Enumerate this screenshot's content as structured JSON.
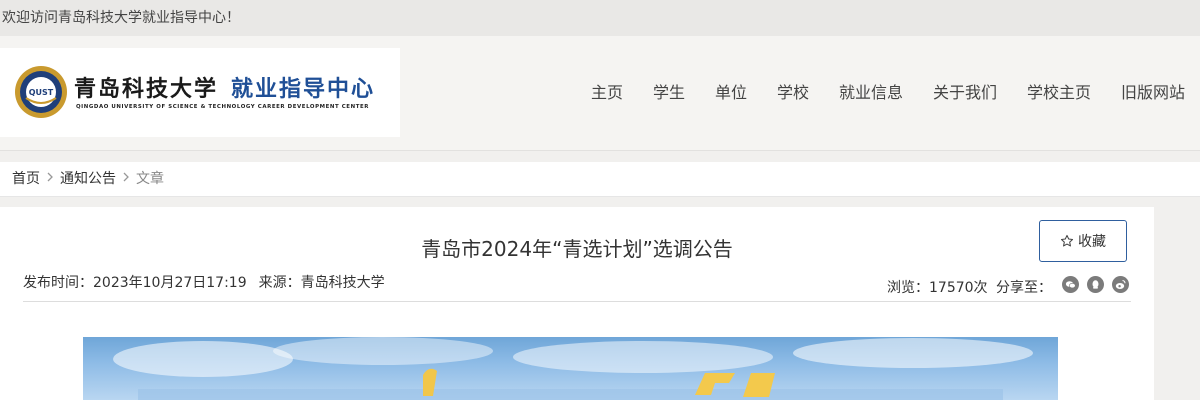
{
  "topbar": {
    "welcome": "欢迎访问青岛科技大学就业指导中心！"
  },
  "logo": {
    "title_part1": "青岛科技大学",
    "title_part2": "就业指导中心",
    "subtitle": "QINGDAO UNIVERSITY OF SCIENCE & TECHNOLOGY CAREER DEVELOPMENT CENTER",
    "emblem_text": "QUST",
    "brand_color": "#1f4f96"
  },
  "nav": {
    "items": [
      {
        "label": "主页"
      },
      {
        "label": "学生"
      },
      {
        "label": "单位"
      },
      {
        "label": "学校"
      },
      {
        "label": "就业信息"
      },
      {
        "label": "关于我们"
      },
      {
        "label": "学校主页"
      },
      {
        "label": "旧版网站"
      }
    ]
  },
  "breadcrumb": {
    "items": [
      {
        "label": "首页"
      },
      {
        "label": "通知公告"
      },
      {
        "label": "文章"
      }
    ],
    "separator_icon": "chevron-right-icon"
  },
  "article": {
    "title": "青岛市2024年“青选计划”选调公告",
    "favorite_label": "收藏",
    "favorite_icon": "star-outline-icon",
    "publish_time": "发布时间：2023年10月27日17:19",
    "source": "来源：青岛科技大学",
    "views": "浏览：17570次",
    "share_label": "分享至：",
    "share_icons": [
      "wechat-icon",
      "qq-icon",
      "weibo-icon"
    ]
  }
}
